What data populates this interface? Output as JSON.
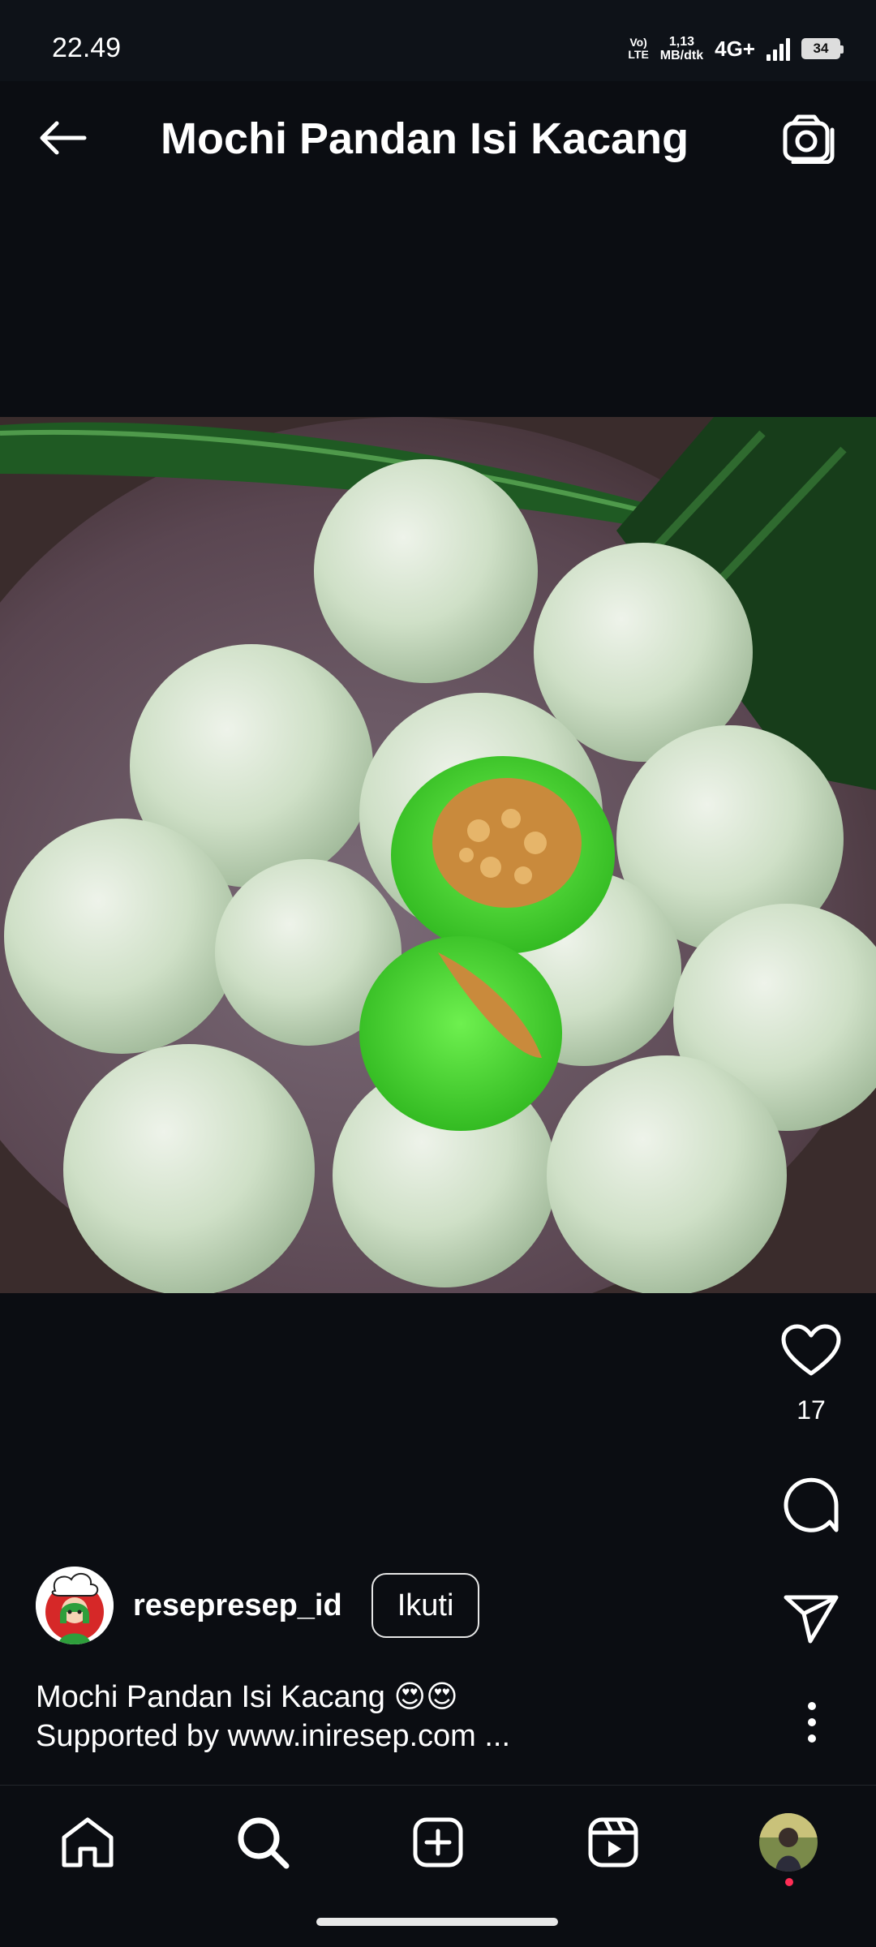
{
  "status_bar": {
    "time": "22.49",
    "volte": "Vo)",
    "lte": "LTE",
    "speed_value": "1,13",
    "speed_unit": "MB/dtk",
    "network": "4G+",
    "battery": "34"
  },
  "header": {
    "title": "Mochi Pandan Isi Kacang",
    "back_icon": "arrow-left-icon",
    "camera_icon": "camera-icon"
  },
  "post": {
    "image_icon": "mochi-photo",
    "likes": "17",
    "author": {
      "username": "resepresep_id",
      "follow_label": "Ikuti"
    },
    "caption": {
      "line1": "Mochi Pandan Isi Kacang 😍😍",
      "line2": "Supported by www.iniresep.com ..."
    }
  },
  "actions": {
    "like_icon": "heart-icon",
    "comment_icon": "comment-icon",
    "share_icon": "send-icon",
    "more_icon": "more-vertical-icon"
  },
  "bottom_nav": {
    "items": [
      "home-icon",
      "search-icon",
      "add-icon",
      "reels-icon",
      "profile-icon"
    ]
  },
  "colors": {
    "background": "#0b0d12",
    "text": "#ffffff",
    "notification_dot": "#ff2d55",
    "mochi_green": "#cfe3c6",
    "filling_green": "#3fcf2a"
  }
}
